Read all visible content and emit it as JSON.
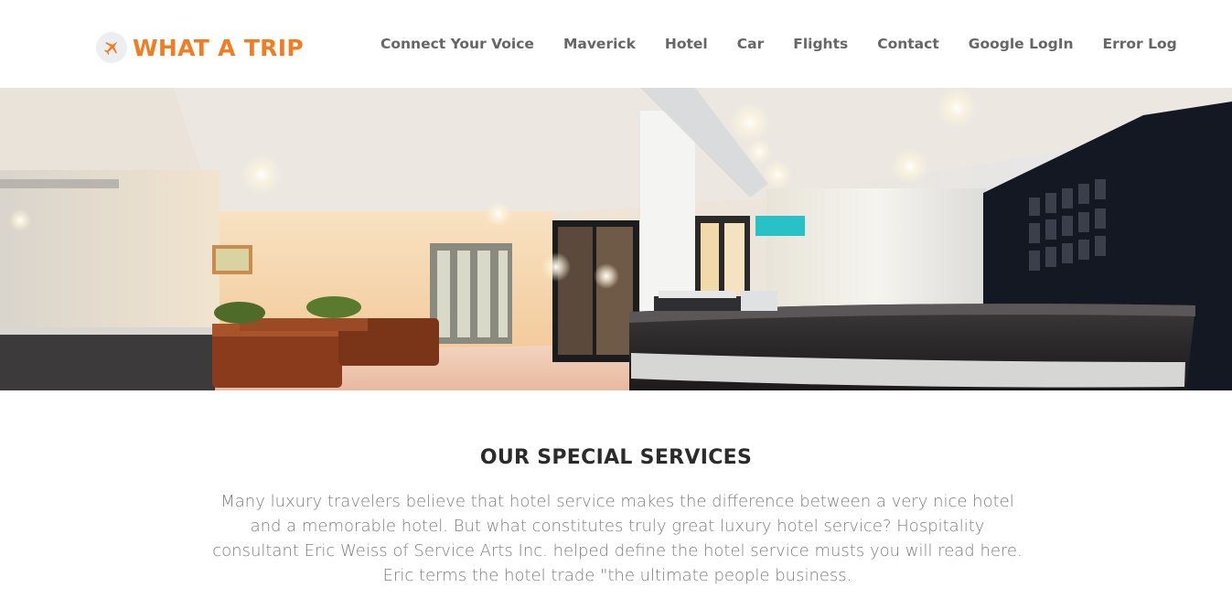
{
  "brand": {
    "name": "WHAT A TRIP",
    "icon": "airplane-icon",
    "color": "#f47c20"
  },
  "nav": {
    "items": [
      {
        "label": "Connect Your Voice"
      },
      {
        "label": "Maverick"
      },
      {
        "label": "Hotel"
      },
      {
        "label": "Car"
      },
      {
        "label": "Flights"
      },
      {
        "label": "Contact"
      },
      {
        "label": "Google LogIn"
      },
      {
        "label": "Error Log"
      }
    ]
  },
  "hero": {
    "image": "hotel-lobby-reception-photo"
  },
  "services": {
    "title": "OUR SPECIAL SERVICES",
    "text": "Many luxury travelers believe that hotel service makes the difference between a very nice hotel and a memorable hotel. But what constitutes truly great luxury hotel service? Hospitality consultant Eric Weiss of Service Arts Inc. helped define the hotel service musts you will read here. Eric terms the hotel trade \"the ultimate people business."
  }
}
